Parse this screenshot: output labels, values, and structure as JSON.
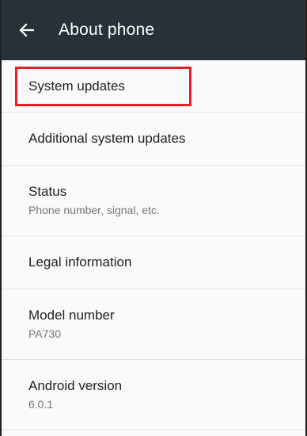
{
  "toolbar": {
    "back_icon": "arrow-back-icon",
    "title": "About phone",
    "background": "#263238"
  },
  "highlight_color": "#e8202a",
  "items": [
    {
      "title": "System updates",
      "summary": null,
      "highlighted": true
    },
    {
      "title": "Additional system updates",
      "summary": null
    },
    {
      "title": "Status",
      "summary": "Phone number, signal, etc."
    },
    {
      "title": "Legal information",
      "summary": null
    },
    {
      "title": "Model number",
      "summary": "PA730"
    },
    {
      "title": "Android version",
      "summary": "6.0.1"
    }
  ]
}
